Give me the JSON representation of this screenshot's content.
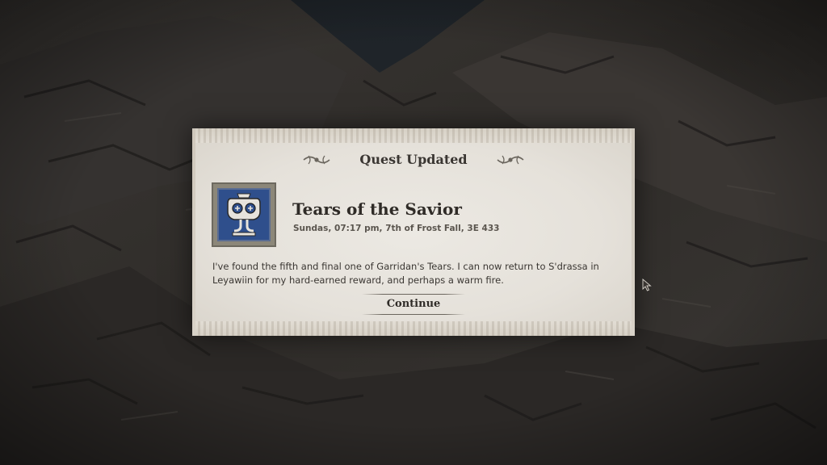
{
  "dialog": {
    "header_title": "Quest Updated",
    "quest": {
      "icon": "scroll-idol-icon",
      "title": "Tears of the Savior",
      "date": "Sundas, 07:17 pm, 7th of Frost Fall, 3E 433",
      "description": "I've found the fifth and final one of Garridan's Tears. I can now return to S'drassa in Leyawiin for my hard-earned reward, and perhaps a warm fire."
    },
    "continue_label": "Continue"
  },
  "colors": {
    "parchment": "#e5e1da",
    "icon_background": "#2f4f8c",
    "text": "#3a3632",
    "backdrop": "#2a2826"
  }
}
